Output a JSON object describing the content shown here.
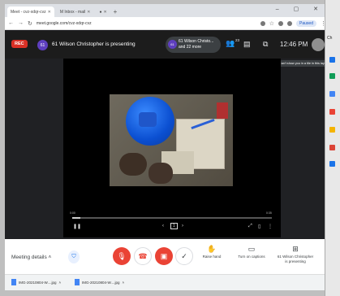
{
  "browser": {
    "tabs": [
      {
        "label": "Meet - cvz-xdqr-cvz",
        "active": true
      },
      {
        "label": "M  Inbox - mail",
        "active": false
      },
      {
        "label": "●",
        "active": false
      }
    ],
    "new_tab": "+",
    "window_controls": "– ▢ ✕",
    "url": "meet.google.com/cvz-xdqr-cvz",
    "paused_label": "Paused"
  },
  "meet": {
    "rec_label": "REC",
    "presenter_avatar": "61",
    "presenting_text": "61 Wilson Christopher is presenting",
    "participants_chip": {
      "avatar": "61",
      "line1": "61 Wilson Christo...",
      "line2": "and 22 more"
    },
    "people_count": "23",
    "time": "12:46 PM",
    "tooltip": "Can't show you in a tile in this layout"
  },
  "video_overlay": {
    "page_label": "1",
    "time_left": "0:00",
    "time_right": "0:35"
  },
  "controls": {
    "meeting_details": "Meeting details",
    "raise_hand": "Raise hand",
    "captions": "Turn on captions",
    "presenting_line1": "61 Wilson Christopher",
    "presenting_line2": "is presenting"
  },
  "downloads": [
    {
      "name": "IMG-20210804-W....jpg"
    },
    {
      "name": "IMG-20210804-W....jpg"
    }
  ],
  "desktop": {
    "top_label": "Ch",
    "icons": [
      "#1a73e8",
      "#0f9d58",
      "#4285f4",
      "#ea4335",
      "#f4b400",
      "#db4437",
      "#1a73e8"
    ]
  }
}
